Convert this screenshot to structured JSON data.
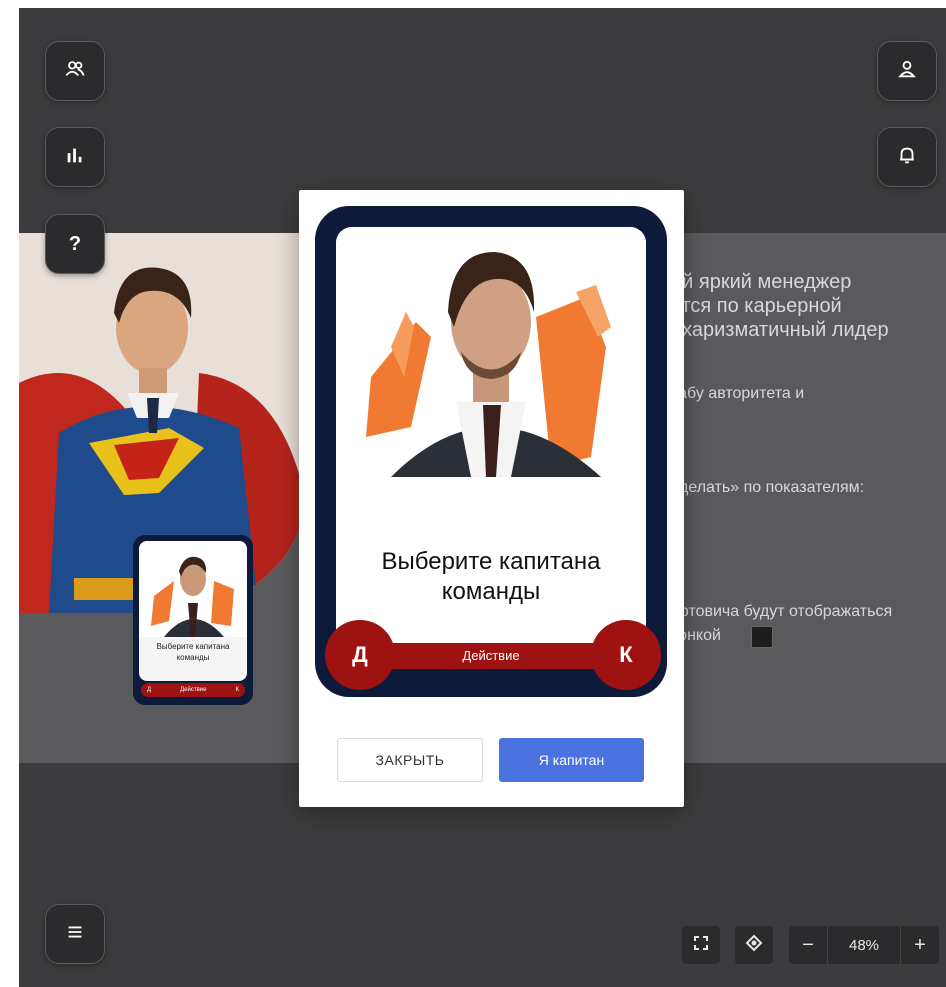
{
  "toolbar_left": {
    "team_icon": "users-icon",
    "stats_icon": "bar-chart-icon",
    "help_label": "?"
  },
  "toolbar_right": {
    "profile_icon": "user-icon",
    "notifications_icon": "bell-icon"
  },
  "background_text": {
    "line1": "ий яркий менеджер",
    "line2": "ется по карьерной",
    "line3": ", харизматичный лидер",
    "line4": "табу авторитета и",
    "line5": "сделать» по показателям:",
    "line6": "ертовича будут отображаться",
    "line7": "конкой"
  },
  "mini_card": {
    "title": "Выберите капитана команды",
    "left_letter": "Д",
    "center_label": "Действие",
    "right_letter": "К"
  },
  "modal": {
    "card_title": "Выберите капитана команды",
    "action_left": "Д",
    "action_label": "Действие",
    "action_right": "К",
    "close_button": "ЗАКРЫТЬ",
    "captain_button": "Я капитан"
  },
  "bottom": {
    "menu_icon": "hamburger-menu-icon",
    "fullscreen_icon": "fullscreen-icon",
    "locate_icon": "target-icon",
    "zoom_minus": "−",
    "zoom_value": "48%",
    "zoom_plus": "+"
  },
  "colors": {
    "card_navy": "#0d1a3a",
    "action_red": "#9e1212",
    "primary_blue": "#4a73e0",
    "app_bg": "#3c3c3e"
  }
}
